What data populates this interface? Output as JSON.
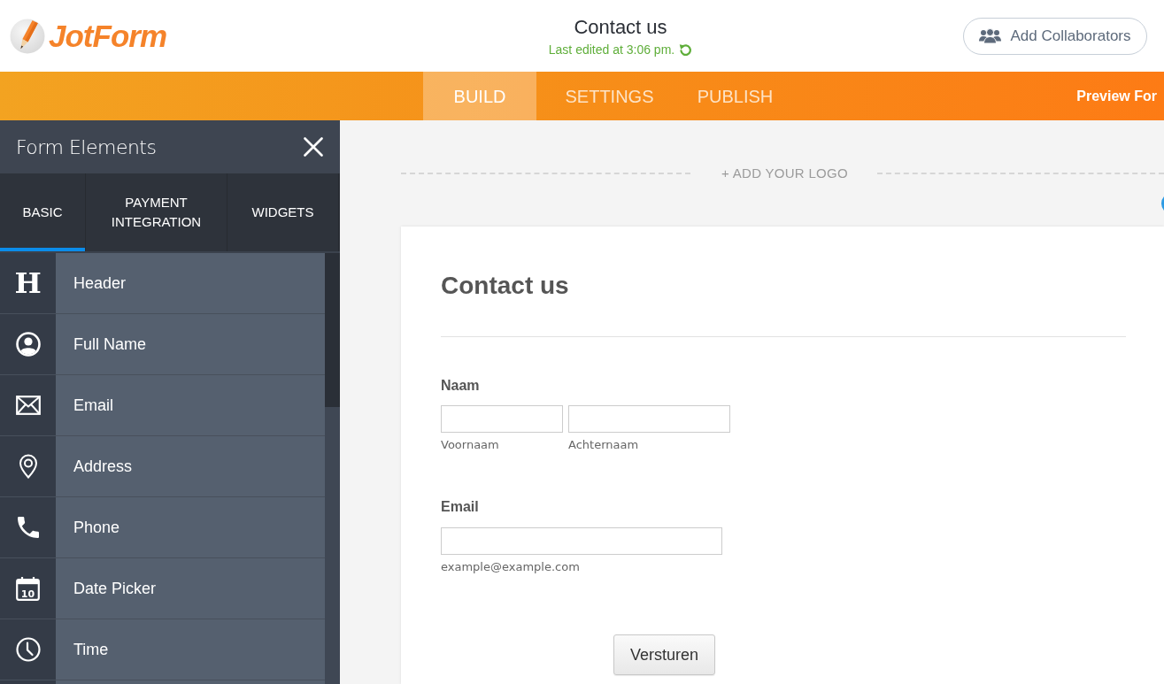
{
  "header": {
    "logo": "JotForm",
    "title": "Contact us",
    "last_edited": "Last edited at 3:06 pm.",
    "collaborators_button": "Add Collaborators"
  },
  "nav_tabs": [
    {
      "label": "BUILD",
      "selected": true
    },
    {
      "label": "SETTINGS",
      "selected": false
    },
    {
      "label": "PUBLISH",
      "selected": false
    }
  ],
  "preview_link": "Preview For",
  "sidebar": {
    "title": "Form Elements",
    "tabs": [
      {
        "label": "BASIC",
        "selected": true
      },
      {
        "label": "PAYMENT INTEGRATION",
        "selected": false
      },
      {
        "label": "WIDGETS",
        "selected": false
      }
    ],
    "items": [
      {
        "label": "Header",
        "glyph": "H"
      },
      {
        "label": "Full Name"
      },
      {
        "label": "Email"
      },
      {
        "label": "Address"
      },
      {
        "label": "Phone"
      },
      {
        "label": "Date Picker",
        "glyph": "10"
      },
      {
        "label": "Time"
      }
    ]
  },
  "canvas": {
    "logo_placeholder": "+ ADD YOUR LOGO",
    "form": {
      "title": "Contact us",
      "fields": [
        {
          "label": "Naam",
          "inputs": [
            {
              "sublabel": "Voornaam"
            },
            {
              "sublabel": "Achternaam"
            }
          ]
        },
        {
          "label": "Email",
          "inputs": [
            {
              "sublabel": "example@example.com"
            }
          ]
        }
      ],
      "submit_button": "Versturen"
    }
  }
}
